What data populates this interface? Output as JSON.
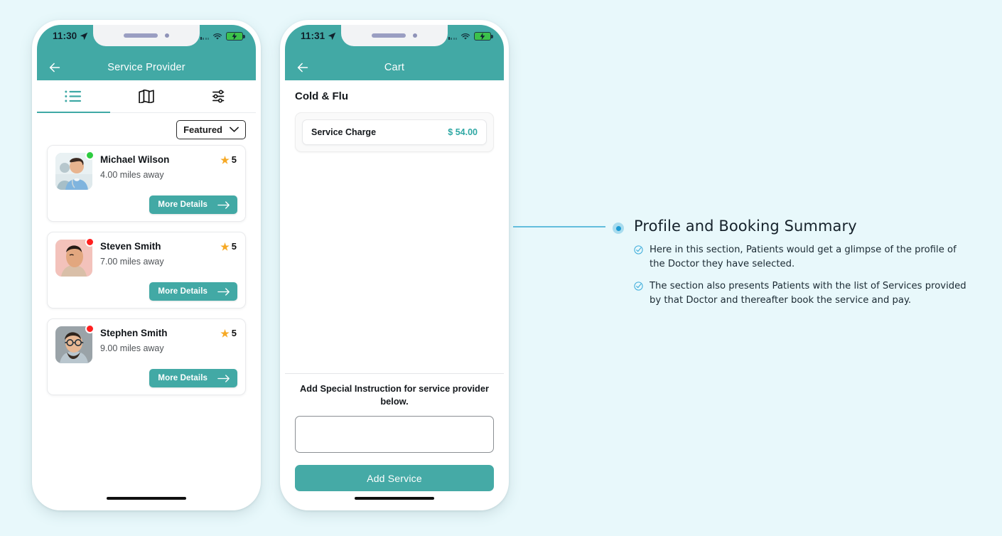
{
  "colors": {
    "page_background": "#E8F8FB",
    "brand_teal": "#42A9A5",
    "accent_blue": "#1C9BD4",
    "connector_blue": "#63BEDC",
    "star_gold": "#F6A925",
    "price_teal": "#2FA8A4",
    "online_green": "#2ECC40",
    "offline_red": "#FF2020"
  },
  "phones": [
    {
      "id": "service-provider",
      "status_bar": {
        "time": "11:30",
        "location_icon": "location-arrow-icon",
        "signal_icon": "cellular-signal-icon",
        "wifi_icon": "wifi-icon",
        "battery_icon": "battery-charging-icon"
      },
      "appbar": {
        "back_icon": "back-arrow-icon",
        "title": "Service Provider"
      },
      "tabs": [
        {
          "icon": "list-view-icon",
          "name": "tab-list",
          "active": true
        },
        {
          "icon": "map-view-icon",
          "name": "tab-map",
          "active": false
        },
        {
          "icon": "filter-sliders-icon",
          "name": "tab-filter",
          "active": false
        }
      ],
      "sort": {
        "label": "Featured",
        "chevron_icon": "chevron-down-icon"
      },
      "providers": [
        {
          "name": "Michael Wilson",
          "distance": "4.00 miles away",
          "rating": "5",
          "star_icon": "star-icon",
          "status": "online",
          "button_label": "More Details",
          "button_icon": "arrow-right-icon"
        },
        {
          "name": "Steven Smith",
          "distance": "7.00 miles away",
          "rating": "5",
          "star_icon": "star-icon",
          "status": "offline",
          "button_label": "More Details",
          "button_icon": "arrow-right-icon"
        },
        {
          "name": "Stephen Smith",
          "distance": "9.00 miles away",
          "rating": "5",
          "star_icon": "star-icon",
          "status": "offline",
          "button_label": "More Details",
          "button_icon": "arrow-right-icon"
        }
      ]
    },
    {
      "id": "cart",
      "status_bar": {
        "time": "11:31",
        "location_icon": "location-arrow-icon",
        "signal_icon": "cellular-signal-icon",
        "wifi_icon": "wifi-icon",
        "battery_icon": "battery-charging-icon"
      },
      "appbar": {
        "back_icon": "back-arrow-icon",
        "title": "Cart"
      },
      "cart": {
        "section_title": "Cold & Flu",
        "line_items": [
          {
            "label": "Service Charge",
            "value": "$ 54.00"
          }
        ],
        "instruction_label": "Add Special Instruction for service provider below.",
        "instruction_value": "",
        "instruction_placeholder": "",
        "primary_button": "Add Service"
      }
    }
  ],
  "annotation": {
    "title": "Profile and Booking Summary",
    "bullets": [
      {
        "check_icon": "circle-check-icon",
        "text": "Here in this section, Patients would get a glimpse of the profile of the Doctor they have selected."
      },
      {
        "check_icon": "circle-check-icon",
        "text": "The section also presents Patients with the list of Services provided by that Doctor and thereafter book the service and pay."
      }
    ]
  }
}
